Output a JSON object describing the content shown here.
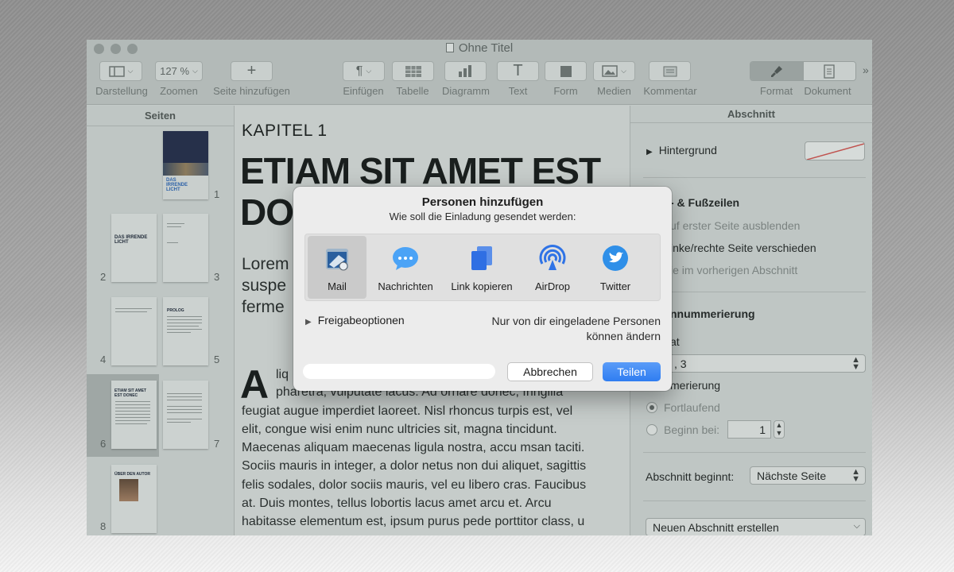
{
  "window": {
    "title": "Ohne Titel"
  },
  "toolbar": {
    "view_label": "Darstellung",
    "zoom_value": "127 %",
    "zoom_label": "Zoomen",
    "add_page_label": "Seite hinzufügen",
    "insert_label": "Einfügen",
    "table_label": "Tabelle",
    "chart_label": "Diagramm",
    "text_label": "Text",
    "shape_label": "Form",
    "media_label": "Medien",
    "comment_label": "Kommentar",
    "format_label": "Format",
    "document_label": "Dokument",
    "more": "»"
  },
  "sidebar": {
    "title": "Seiten",
    "pages": [
      "1",
      "2",
      "3",
      "4",
      "5",
      "6",
      "7",
      "8"
    ],
    "cover_text": "DAS IRRENDE LICHT",
    "p2_title": "DAS IRRENDE LICHT",
    "p5_title": "PROLOG",
    "p6_title": "ETIAM SIT AMET EST DONEC",
    "p8_title": "ÜBER DEN AUTOR"
  },
  "document": {
    "chapter": "KAPITEL 1",
    "heading_line1": "ETIAM SIT AMET EST",
    "heading_line2": "DO",
    "lead_lines": [
      "Lorem",
      "suspe",
      "ferme"
    ],
    "dropcap": "A",
    "body_first": "liq",
    "body_lines": [
      "pharetra, vulputate lacus. Ad ornare donec, fringilla",
      "feugiat augue imperdiet laoreet. Nisl rhoncus turpis est, vel",
      "elit, congue wisi enim nunc ultricies sit, magna tincidunt.",
      "Maecenas aliquam maecenas ligula nostra, accu msan taciti.",
      "Sociis mauris in integer, a dolor netus non dui aliquet, sagittis",
      "felis sodales, dolor sociis mauris, vel eu libero cras. Faucibus",
      "at. Duis montes, tellus lobortis lacus amet arcu et. Arcu",
      "habitasse elementum est, ipsum purus pede porttitor class, u"
    ]
  },
  "inspector": {
    "title": "Abschnitt",
    "background_label": "Hintergrund",
    "header_footer_label": "- & Fußzeilen",
    "hide_first_page": "uf erster Seite ausblenden",
    "left_right_diff": "inke/rechte Seite verschieden",
    "prev_section": "ie im vorherigen Abschnitt",
    "numbering_label": "nnummerierung",
    "format_label": "at",
    "format_value": ", 3",
    "numbering_sub": "merierung",
    "continuous": "Fortlaufend",
    "start_at": "Beginn bei:",
    "start_value": "1",
    "section_starts_label": "Abschnitt beginnt:",
    "section_starts_value": "Nächste Seite",
    "new_section_button": "Neuen Abschnitt erstellen"
  },
  "dialog": {
    "title": "Personen hinzufügen",
    "subtitle": "Wie soll die Einladung gesendet werden:",
    "options": [
      {
        "label": "Mail",
        "icon": "mail-icon",
        "selected": true
      },
      {
        "label": "Nachrichten",
        "icon": "messages-icon"
      },
      {
        "label": "Link kopieren",
        "icon": "copy-link-icon"
      },
      {
        "label": "AirDrop",
        "icon": "airdrop-icon"
      },
      {
        "label": "Twitter",
        "icon": "twitter-icon"
      }
    ],
    "share_options_label": "Freigabeoptionen",
    "permission_line1": "Nur von dir eingeladene Personen",
    "permission_line2": "können ändern",
    "email_placeholder": "",
    "cancel_label": "Abbrechen",
    "share_label": "Teilen"
  },
  "colors": {
    "accent": "#2f7df1",
    "dim_overlay": "#c3c9c7"
  }
}
